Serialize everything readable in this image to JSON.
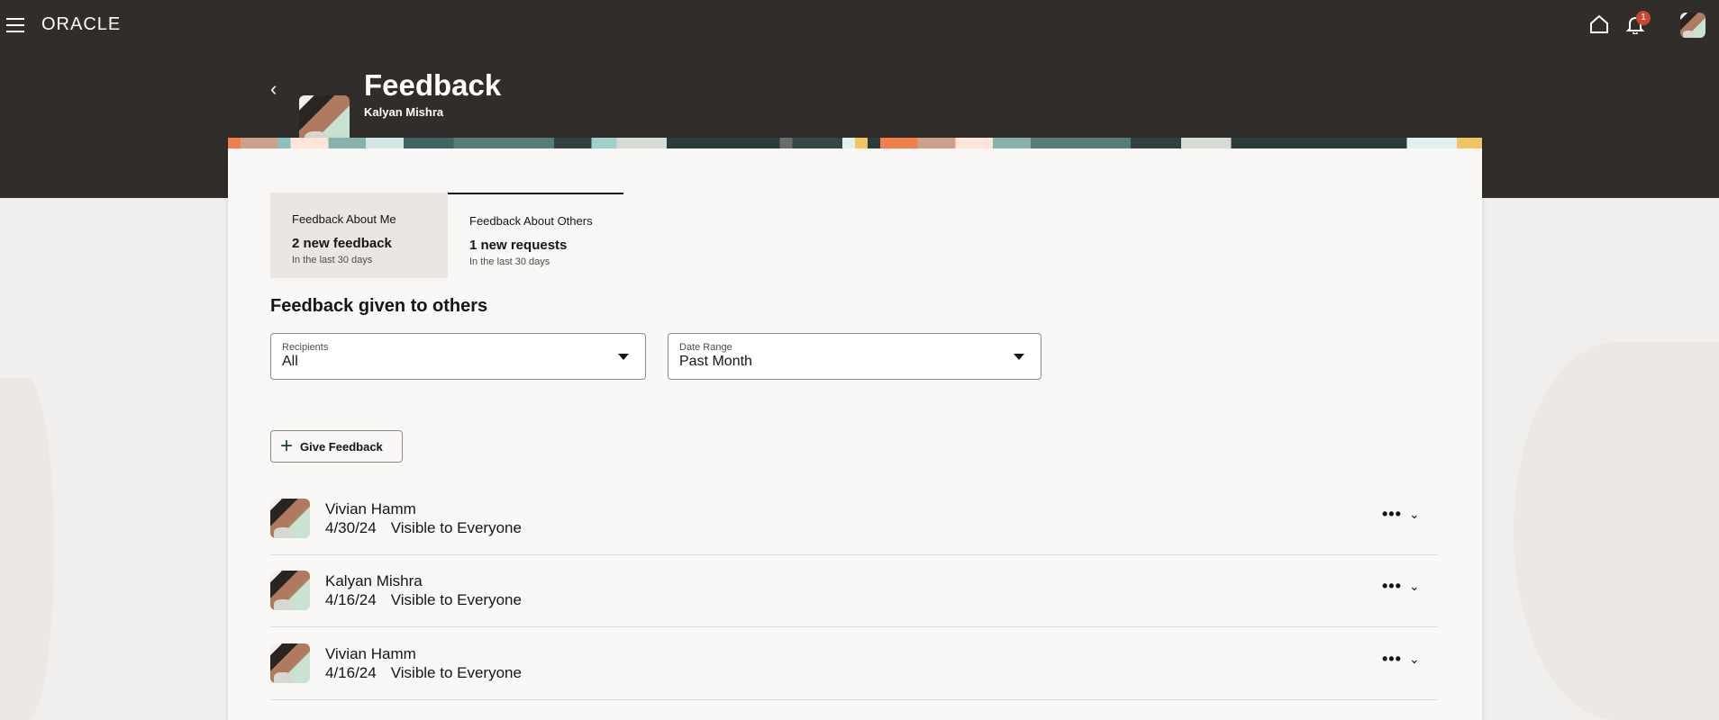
{
  "header": {
    "brand": "ORACLE",
    "notification_count": "1",
    "back_label": "‹",
    "title": "Feedback",
    "subtitle": "Kalyan Mishra"
  },
  "tabs": [
    {
      "label": "Feedback About Me",
      "headline": "2 new feedback",
      "sub": "In the last 30 days",
      "selected": true
    },
    {
      "label": "Feedback About Others",
      "headline": "1 new requests",
      "sub": "In the last 30 days",
      "active": true
    }
  ],
  "section_title": "Feedback given to others",
  "filters": {
    "recipients": {
      "label": "Recipients",
      "value": "All"
    },
    "date_range": {
      "label": "Date Range",
      "value": "Past Month"
    }
  },
  "give_feedback": {
    "icon": "+",
    "label": "Give Feedback"
  },
  "rows": [
    {
      "name": "Vivian Hamm",
      "date": "4/30/24",
      "visibility": "Visible to Everyone"
    },
    {
      "name": "Kalyan Mishra",
      "date": "4/16/24",
      "visibility": "Visible to Everyone"
    },
    {
      "name": "Vivian Hamm",
      "date": "4/16/24",
      "visibility": "Visible to Everyone"
    }
  ],
  "row_actions": {
    "more": "•••",
    "expand": "⌄"
  },
  "colors": {
    "header_bg": "#312d2a",
    "badge": "#c74634",
    "card_bg": "#f9f8f6"
  }
}
